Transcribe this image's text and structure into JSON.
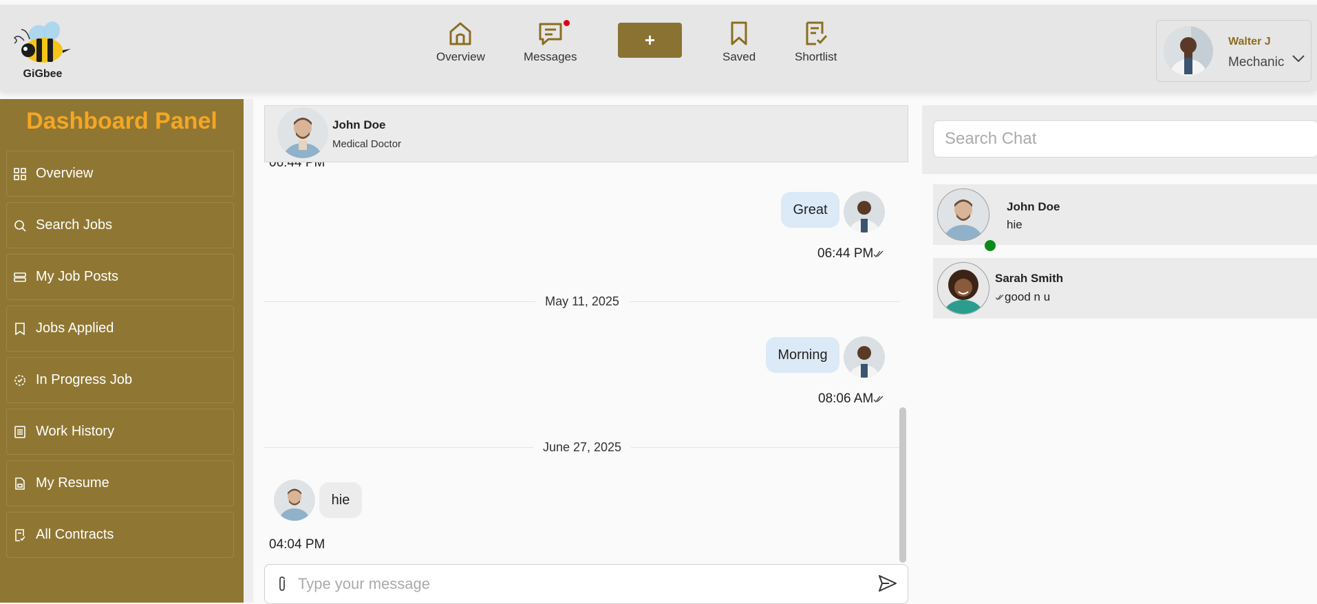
{
  "app": {
    "name": "GiGbee"
  },
  "header": {
    "nav": [
      {
        "label": "Overview",
        "icon": "home-icon"
      },
      {
        "label": "Messages",
        "icon": "message-icon",
        "has_notification": true
      },
      {
        "label": "Saved",
        "icon": "bookmark-icon"
      },
      {
        "label": "Shortlist",
        "icon": "shortlist-icon"
      }
    ],
    "plus_label": "+",
    "profile": {
      "name": "Walter J",
      "role": "Mechanic"
    }
  },
  "sidebar": {
    "title": "Dashboard Panel",
    "items": [
      {
        "label": "Overview",
        "icon": "grid-icon"
      },
      {
        "label": "Search Jobs",
        "icon": "search-icon"
      },
      {
        "label": "My Job Posts",
        "icon": "stack-icon"
      },
      {
        "label": "Jobs Applied",
        "icon": "bookmark-check-icon"
      },
      {
        "label": "In Progress Job",
        "icon": "progress-icon"
      },
      {
        "label": "Work History",
        "icon": "list-icon"
      },
      {
        "label": "My Resume",
        "icon": "file-icon"
      },
      {
        "label": "All Contracts",
        "icon": "contract-icon"
      }
    ]
  },
  "chat": {
    "contact": {
      "name": "John Doe",
      "role": "Medical Doctor"
    },
    "cut_time": "06:44 PM",
    "messages": [
      {
        "text": "Great",
        "time": "06:44 PM"
      },
      {
        "date": "May 11, 2025"
      },
      {
        "text": "Morning",
        "time": "08:06 AM"
      },
      {
        "date": "June 27, 2025"
      },
      {
        "text": "hie",
        "time": "04:04 PM"
      }
    ],
    "composer_placeholder": "Type your message"
  },
  "conversations": {
    "search_placeholder": "Search Chat",
    "items": [
      {
        "name": "John Doe",
        "preview": "hie",
        "online": true
      },
      {
        "name": "Sarah Smith",
        "preview": "good n u",
        "read_receipt": true
      }
    ]
  },
  "colors": {
    "brand": "#8f7733",
    "accent": "#f5a623",
    "bubble_out": "#dce9f6",
    "online": "#0a8a1a",
    "notification": "#e0001a"
  }
}
